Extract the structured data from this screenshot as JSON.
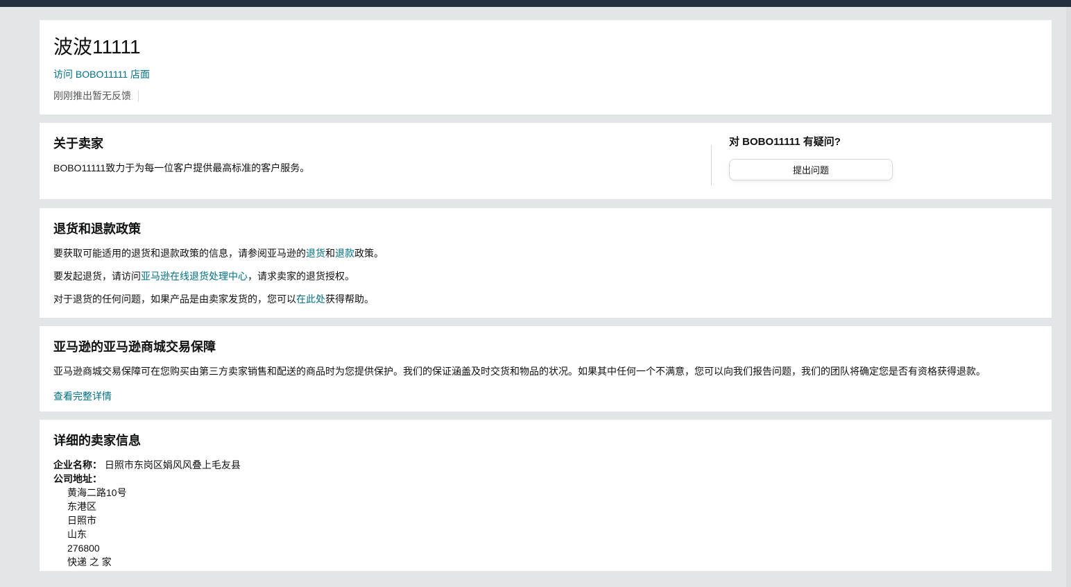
{
  "theme": {
    "topbar_color": "#232f3e",
    "page_background": "#e3e6e6",
    "card_background": "#ffffff",
    "link_color": "#007185",
    "text_color": "#0f1111",
    "secondary_text_color": "#565959",
    "border_color": "#d5d9d9"
  },
  "header": {
    "title": "波波11111",
    "storefront_link": "访问 BOBO11111 店面",
    "feedback_status": "刚刚推出暂无反馈"
  },
  "about": {
    "heading": "关于卖家",
    "body": "BOBO11111致力于为每一位客户提供最高标准的客户服务。",
    "question_heading": "对 BOBO11111 有疑问?",
    "ask_button_label": "提出问题"
  },
  "returns": {
    "heading": "退货和退款政策",
    "p1_pre": "要获取可能适用的退货和退款政策的信息，请参阅亚马逊的",
    "p1_link1": "退货",
    "p1_mid": "和",
    "p1_link2": "退款",
    "p1_post": "政策。",
    "p2_pre": "要发起退货，请访问",
    "p2_link": "亚马逊在线退货处理中心",
    "p2_post": "，请求卖家的退货授权。",
    "p3_pre": "对于退货的任何问题，如果产品是由卖家发货的，您可以",
    "p3_link": "在此处",
    "p3_post": "获得帮助。"
  },
  "guarantee": {
    "heading": "亚马逊的亚马逊商城交易保障",
    "body": "亚马逊商城交易保障可在您购买由第三方卖家销售和配送的商品时为您提供保护。我们的保证涵盖及时交货和物品的状况。如果其中任何一个不满意，您可以向我们报告问题，我们的团队将确定您是否有资格获得退款。",
    "details_link": "查看完整详情"
  },
  "seller_info": {
    "heading": "详细的卖家信息",
    "business_name_label": "企业名称：",
    "business_name": "日照市东岗区娟风风叠上毛友县",
    "address_label": "公司地址：",
    "address_lines": [
      "黄海二路10号",
      "东港区",
      "日照市",
      "山东",
      "276800",
      "快递 之 家"
    ]
  }
}
